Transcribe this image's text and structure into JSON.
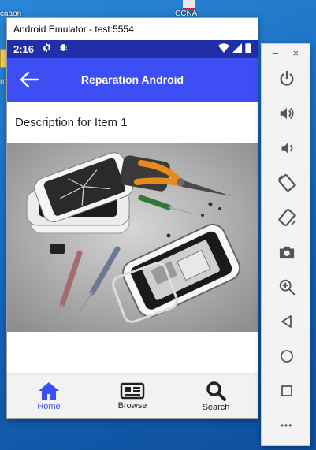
{
  "desktop": {
    "left_label_top": "caaon",
    "left_label_bottom": "me",
    "ccna_label": "CCNA"
  },
  "window": {
    "title": "Android Emulator - test:5554"
  },
  "status_bar": {
    "time": "2:16"
  },
  "app_bar": {
    "title": "Reparation Android"
  },
  "item": {
    "description": "Description for Item 1"
  },
  "bottom_nav": {
    "items": [
      {
        "label": "Home",
        "icon": "home-icon",
        "active": true
      },
      {
        "label": "Browse",
        "icon": "browse-icon",
        "active": false
      },
      {
        "label": "Search",
        "icon": "search-icon",
        "active": false
      }
    ]
  },
  "side_toolbar": {
    "minimize": "−",
    "close": "×",
    "buttons": [
      "power-icon",
      "volume-up-icon",
      "volume-down-icon",
      "rotate-left-icon",
      "rotate-right-icon",
      "camera-icon",
      "zoom-icon",
      "back-icon",
      "home-circle-icon",
      "overview-icon",
      "more-icon"
    ],
    "more": "•••"
  },
  "colors": {
    "app_bar": "#3d4ef5",
    "status_bar": "#1f2fa8",
    "active_nav": "#3d4ef5"
  }
}
